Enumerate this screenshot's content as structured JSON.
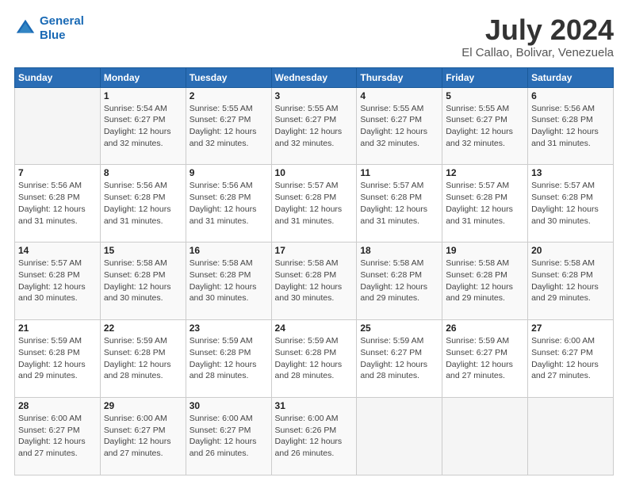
{
  "logo": {
    "line1": "General",
    "line2": "Blue"
  },
  "title": "July 2024",
  "subtitle": "El Callao, Bolivar, Venezuela",
  "header_days": [
    "Sunday",
    "Monday",
    "Tuesday",
    "Wednesday",
    "Thursday",
    "Friday",
    "Saturday"
  ],
  "weeks": [
    [
      {
        "day": "",
        "info": ""
      },
      {
        "day": "1",
        "info": "Sunrise: 5:54 AM\nSunset: 6:27 PM\nDaylight: 12 hours\nand 32 minutes."
      },
      {
        "day": "2",
        "info": "Sunrise: 5:55 AM\nSunset: 6:27 PM\nDaylight: 12 hours\nand 32 minutes."
      },
      {
        "day": "3",
        "info": "Sunrise: 5:55 AM\nSunset: 6:27 PM\nDaylight: 12 hours\nand 32 minutes."
      },
      {
        "day": "4",
        "info": "Sunrise: 5:55 AM\nSunset: 6:27 PM\nDaylight: 12 hours\nand 32 minutes."
      },
      {
        "day": "5",
        "info": "Sunrise: 5:55 AM\nSunset: 6:27 PM\nDaylight: 12 hours\nand 32 minutes."
      },
      {
        "day": "6",
        "info": "Sunrise: 5:56 AM\nSunset: 6:28 PM\nDaylight: 12 hours\nand 31 minutes."
      }
    ],
    [
      {
        "day": "7",
        "info": "Sunrise: 5:56 AM\nSunset: 6:28 PM\nDaylight: 12 hours\nand 31 minutes."
      },
      {
        "day": "8",
        "info": "Sunrise: 5:56 AM\nSunset: 6:28 PM\nDaylight: 12 hours\nand 31 minutes."
      },
      {
        "day": "9",
        "info": "Sunrise: 5:56 AM\nSunset: 6:28 PM\nDaylight: 12 hours\nand 31 minutes."
      },
      {
        "day": "10",
        "info": "Sunrise: 5:57 AM\nSunset: 6:28 PM\nDaylight: 12 hours\nand 31 minutes."
      },
      {
        "day": "11",
        "info": "Sunrise: 5:57 AM\nSunset: 6:28 PM\nDaylight: 12 hours\nand 31 minutes."
      },
      {
        "day": "12",
        "info": "Sunrise: 5:57 AM\nSunset: 6:28 PM\nDaylight: 12 hours\nand 31 minutes."
      },
      {
        "day": "13",
        "info": "Sunrise: 5:57 AM\nSunset: 6:28 PM\nDaylight: 12 hours\nand 30 minutes."
      }
    ],
    [
      {
        "day": "14",
        "info": "Sunrise: 5:57 AM\nSunset: 6:28 PM\nDaylight: 12 hours\nand 30 minutes."
      },
      {
        "day": "15",
        "info": "Sunrise: 5:58 AM\nSunset: 6:28 PM\nDaylight: 12 hours\nand 30 minutes."
      },
      {
        "day": "16",
        "info": "Sunrise: 5:58 AM\nSunset: 6:28 PM\nDaylight: 12 hours\nand 30 minutes."
      },
      {
        "day": "17",
        "info": "Sunrise: 5:58 AM\nSunset: 6:28 PM\nDaylight: 12 hours\nand 30 minutes."
      },
      {
        "day": "18",
        "info": "Sunrise: 5:58 AM\nSunset: 6:28 PM\nDaylight: 12 hours\nand 29 minutes."
      },
      {
        "day": "19",
        "info": "Sunrise: 5:58 AM\nSunset: 6:28 PM\nDaylight: 12 hours\nand 29 minutes."
      },
      {
        "day": "20",
        "info": "Sunrise: 5:58 AM\nSunset: 6:28 PM\nDaylight: 12 hours\nand 29 minutes."
      }
    ],
    [
      {
        "day": "21",
        "info": "Sunrise: 5:59 AM\nSunset: 6:28 PM\nDaylight: 12 hours\nand 29 minutes."
      },
      {
        "day": "22",
        "info": "Sunrise: 5:59 AM\nSunset: 6:28 PM\nDaylight: 12 hours\nand 28 minutes."
      },
      {
        "day": "23",
        "info": "Sunrise: 5:59 AM\nSunset: 6:28 PM\nDaylight: 12 hours\nand 28 minutes."
      },
      {
        "day": "24",
        "info": "Sunrise: 5:59 AM\nSunset: 6:28 PM\nDaylight: 12 hours\nand 28 minutes."
      },
      {
        "day": "25",
        "info": "Sunrise: 5:59 AM\nSunset: 6:27 PM\nDaylight: 12 hours\nand 28 minutes."
      },
      {
        "day": "26",
        "info": "Sunrise: 5:59 AM\nSunset: 6:27 PM\nDaylight: 12 hours\nand 27 minutes."
      },
      {
        "day": "27",
        "info": "Sunrise: 6:00 AM\nSunset: 6:27 PM\nDaylight: 12 hours\nand 27 minutes."
      }
    ],
    [
      {
        "day": "28",
        "info": "Sunrise: 6:00 AM\nSunset: 6:27 PM\nDaylight: 12 hours\nand 27 minutes."
      },
      {
        "day": "29",
        "info": "Sunrise: 6:00 AM\nSunset: 6:27 PM\nDaylight: 12 hours\nand 27 minutes."
      },
      {
        "day": "30",
        "info": "Sunrise: 6:00 AM\nSunset: 6:27 PM\nDaylight: 12 hours\nand 26 minutes."
      },
      {
        "day": "31",
        "info": "Sunrise: 6:00 AM\nSunset: 6:26 PM\nDaylight: 12 hours\nand 26 minutes."
      },
      {
        "day": "",
        "info": ""
      },
      {
        "day": "",
        "info": ""
      },
      {
        "day": "",
        "info": ""
      }
    ]
  ]
}
